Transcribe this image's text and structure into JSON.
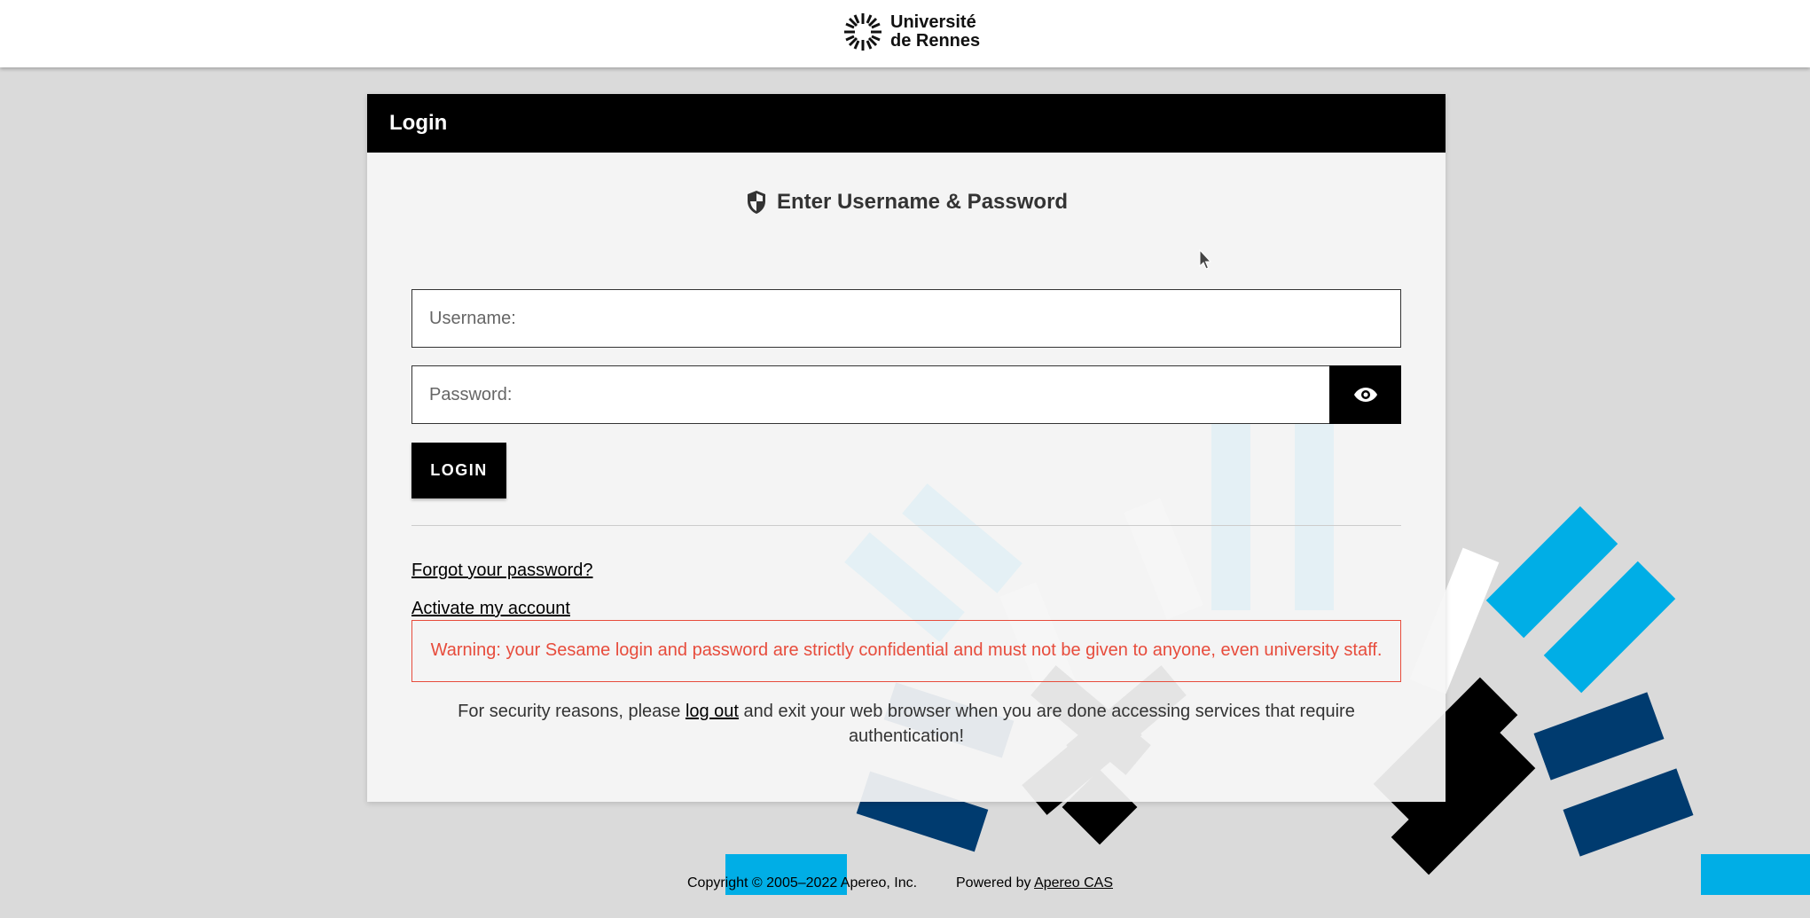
{
  "header": {
    "logo_line1": "Université",
    "logo_line2": "de Rennes"
  },
  "card": {
    "title": "Login",
    "form_heading": "Enter Username & Password",
    "username_placeholder": "Username:",
    "password_placeholder": "Password:",
    "login_label": "LOGIN",
    "forgot_link": "Forgot your password?",
    "activate_link": "Activate my account",
    "warning": "Warning: your Sesame login and password are strictly confidential and must not be given to anyone, even university staff.",
    "security_before": "For security reasons, please ",
    "security_link": "log out",
    "security_after": " and exit your web browser when you are done accessing services that require authentication!"
  },
  "footer": {
    "copyright": "Copyright © 2005–2022 Apereo, Inc.",
    "powered_prefix": "Powered by ",
    "powered_link": "Apereo CAS"
  },
  "colors": {
    "accent_black": "#000000",
    "warning_red": "#e74c3c",
    "deco_cyan": "#00aee6",
    "deco_navy": "#003b6f",
    "background": "#dadada"
  }
}
